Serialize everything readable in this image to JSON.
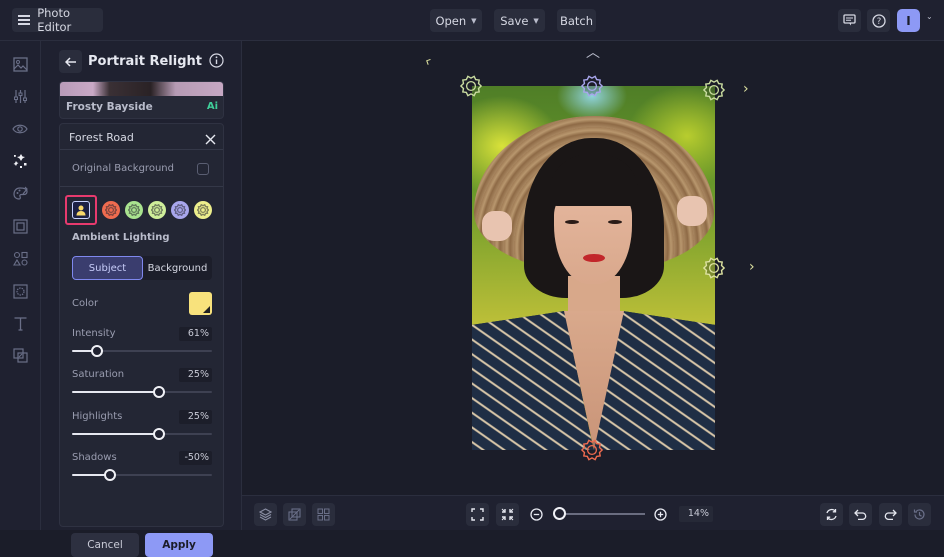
{
  "topbar": {
    "app_title": "Photo Editor",
    "open_label": "Open",
    "save_label": "Save",
    "batch_label": "Batch",
    "avatar_initial": "I"
  },
  "sidebar": {
    "items": [
      {
        "name": "image-icon",
        "active": false
      },
      {
        "name": "adjust-icon",
        "active": false
      },
      {
        "name": "eye-icon",
        "active": false
      },
      {
        "name": "sparkle-effects-icon",
        "active": true
      },
      {
        "name": "palette-icon",
        "active": false
      },
      {
        "name": "frame-icon",
        "active": false
      },
      {
        "name": "shapes-icon",
        "active": false
      },
      {
        "name": "texture-icon",
        "active": false
      },
      {
        "name": "text-icon",
        "active": false
      },
      {
        "name": "overlay-icon",
        "active": false
      }
    ]
  },
  "panel": {
    "title": "Portrait Relight",
    "preset": {
      "name": "Frosty Bayside",
      "badge": "Ai"
    },
    "settings": {
      "title": "Forest Road",
      "original_background_label": "Original Background",
      "original_background_checked": false,
      "lights": [
        {
          "name": "subject",
          "selected": true
        },
        {
          "name": "light-1",
          "color": "#ef6b4f"
        },
        {
          "name": "light-2",
          "color": "#a9e38f"
        },
        {
          "name": "light-3",
          "color": "#cfee9a"
        },
        {
          "name": "light-4",
          "color": "#a8a6ec"
        },
        {
          "name": "light-5",
          "color": "#ecee8c"
        }
      ],
      "ambient_label": "Ambient Lighting",
      "tabs": [
        {
          "label": "Subject",
          "active": true
        },
        {
          "label": "Background",
          "active": false
        }
      ],
      "color_label": "Color",
      "color_value": "#f8e27c",
      "sliders": [
        {
          "label": "Intensity",
          "value_text": "61%",
          "fraction": 0.18
        },
        {
          "label": "Saturation",
          "value_text": "25%",
          "fraction": 0.62
        },
        {
          "label": "Highlights",
          "value_text": "25%",
          "fraction": 0.62
        },
        {
          "label": "Shadows",
          "value_text": "-50%",
          "fraction": 0.27
        }
      ],
      "cancel_label": "Cancel",
      "apply_label": "Apply"
    }
  },
  "canvas": {
    "handles": [
      {
        "name": "light-handle-top-left",
        "color": "#c9dba0"
      },
      {
        "name": "light-handle-top-center",
        "color": "#a8a6ec"
      },
      {
        "name": "light-handle-top-right",
        "color": "#c9dba0"
      },
      {
        "name": "light-handle-right",
        "color": "#dde2a0"
      },
      {
        "name": "light-handle-bottom",
        "color": "#ef6b4f"
      }
    ]
  },
  "bottombar": {
    "zoom_value": "14%",
    "zoom_fraction": 0.0
  }
}
